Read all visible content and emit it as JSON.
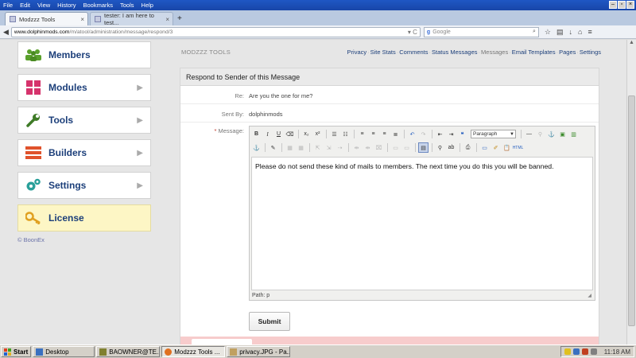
{
  "browser": {
    "menu": [
      "File",
      "Edit",
      "View",
      "History",
      "Bookmarks",
      "Tools",
      "Help"
    ],
    "tabs": [
      {
        "title": "Modzzz Tools",
        "active": true
      },
      {
        "title": "tester: I am here to test...",
        "active": false
      }
    ],
    "new_tab": "+",
    "url_host": "www.dolphinmods.com",
    "url_path": "/m/atool/administration/message/respond/3",
    "search_placeholder": "Google"
  },
  "sidebar": {
    "items": [
      {
        "label": "Members",
        "icon": "members-icon",
        "color": "#5aa02c"
      },
      {
        "label": "Modules",
        "icon": "modules-icon",
        "color": "#d6336c"
      },
      {
        "label": "Tools",
        "icon": "wrench-icon",
        "color": "#3e7b27"
      },
      {
        "label": "Builders",
        "icon": "builders-icon",
        "color": "#e0522c"
      },
      {
        "label": "Settings",
        "icon": "gears-icon",
        "color": "#2aa09a"
      },
      {
        "label": "License",
        "icon": "key-icon",
        "color": "#e0a020"
      }
    ],
    "copyright": "© BoonEx"
  },
  "toplinks": {
    "brand": "MODZZZ TOOLS",
    "links": [
      "Privacy",
      "Site Stats",
      "Comments",
      "Status Messages",
      "Messages",
      "Email Templates",
      "Pages",
      "Settings"
    ],
    "current": "Messages"
  },
  "form": {
    "title": "Respond to Sender of this Message",
    "re_label": "Re:",
    "re_value": "Are you the one for me?",
    "sent_label": "Sent By:",
    "sent_value": "dolphinmods",
    "message_label": "Message:",
    "required_mark": "*",
    "format_value": "Paragraph",
    "body": "Please do not send these kind of mails to members. The next time you do this you will be banned.",
    "path": "Path: p",
    "submit": "Submit"
  },
  "taskbar": {
    "start": "Start",
    "items": [
      {
        "label": "Desktop",
        "active": false
      },
      {
        "label": "BAOWNER@TE...",
        "active": false
      },
      {
        "label": "Modzzz Tools ...",
        "active": true
      },
      {
        "label": "privacy.JPG - Pa...",
        "active": false
      }
    ],
    "clock": "11:18 AM"
  }
}
